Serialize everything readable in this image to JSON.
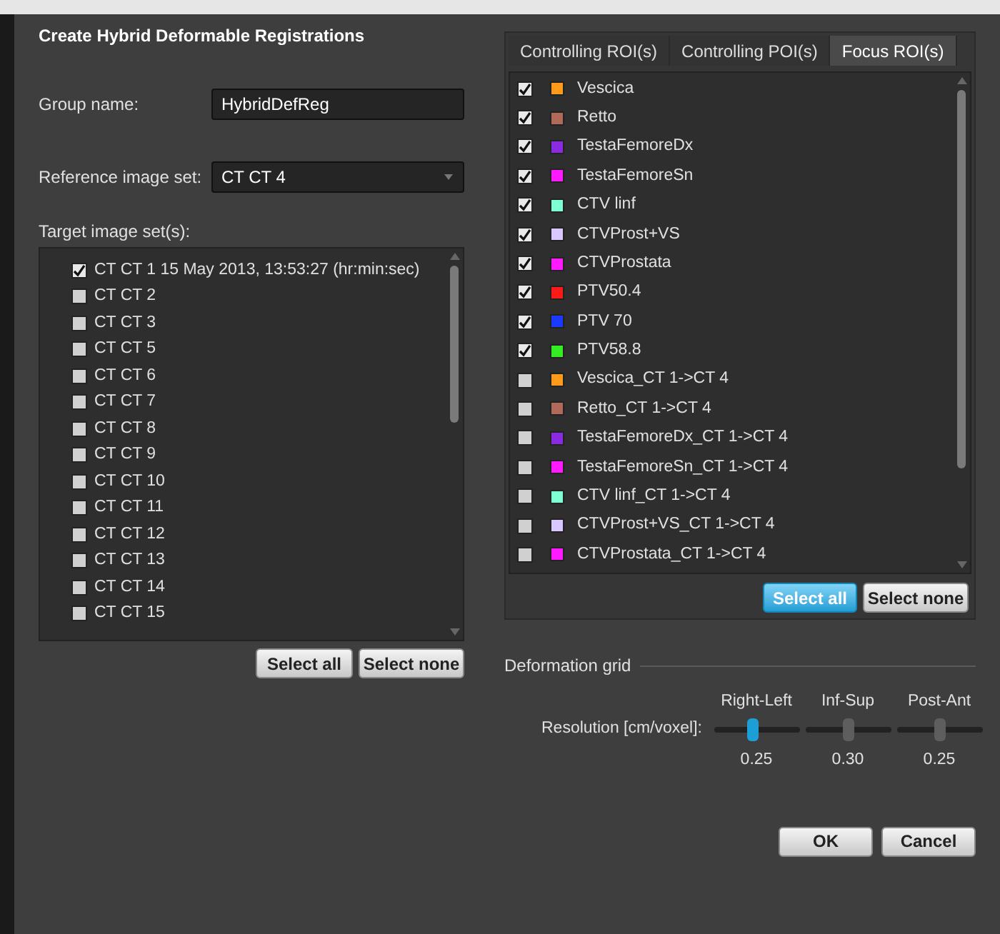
{
  "dialog": {
    "title": "Create Hybrid Deformable Registrations"
  },
  "group_name": {
    "label": "Group name:",
    "value": "HybridDefReg"
  },
  "reference_image_set": {
    "label": "Reference image set:",
    "value": "CT CT 4"
  },
  "target_image_sets": {
    "label": "Target image set(s):",
    "items": [
      {
        "label": "CT CT 1 15 May 2013, 13:53:27 (hr:min:sec)",
        "checked": true
      },
      {
        "label": "CT CT 2",
        "checked": false
      },
      {
        "label": "CT CT 3",
        "checked": false
      },
      {
        "label": "CT CT 5",
        "checked": false
      },
      {
        "label": "CT CT 6",
        "checked": false
      },
      {
        "label": "CT CT 7",
        "checked": false
      },
      {
        "label": "CT CT 8",
        "checked": false
      },
      {
        "label": "CT CT 9",
        "checked": false
      },
      {
        "label": "CT CT 10",
        "checked": false
      },
      {
        "label": "CT CT 11",
        "checked": false
      },
      {
        "label": "CT CT 12",
        "checked": false
      },
      {
        "label": "CT CT 13",
        "checked": false
      },
      {
        "label": "CT CT 14",
        "checked": false
      },
      {
        "label": "CT CT 15",
        "checked": false
      }
    ],
    "buttons": [
      {
        "label": "Select all",
        "highlighted": false
      },
      {
        "label": "Select none",
        "highlighted": false
      }
    ]
  },
  "tabs": [
    {
      "label": "Controlling ROI(s)",
      "selected": false
    },
    {
      "label": "Controlling POI(s)",
      "selected": false
    },
    {
      "label": "Focus ROI(s)",
      "selected": true
    }
  ],
  "rois": {
    "items": [
      {
        "label": "Vescica",
        "checked": true,
        "color": "#ff9a1a"
      },
      {
        "label": "Retto",
        "checked": true,
        "color": "#b06a5a"
      },
      {
        "label": "TestaFemoreDx",
        "checked": true,
        "color": "#8a2be2"
      },
      {
        "label": "TestaFemoreSn",
        "checked": true,
        "color": "#ff1aff"
      },
      {
        "label": "CTV linf",
        "checked": true,
        "color": "#7fffd4"
      },
      {
        "label": "CTVProst+VS",
        "checked": true,
        "color": "#d8c8ff"
      },
      {
        "label": "CTVProstata",
        "checked": true,
        "color": "#ff1aff"
      },
      {
        "label": "PTV50.4",
        "checked": true,
        "color": "#ff1a1a"
      },
      {
        "label": "PTV 70",
        "checked": true,
        "color": "#1a3aff"
      },
      {
        "label": "PTV58.8",
        "checked": true,
        "color": "#33ee22"
      },
      {
        "label": "Vescica_CT 1->CT 4",
        "checked": false,
        "color": "#ff9a1a"
      },
      {
        "label": "Retto_CT 1->CT 4",
        "checked": false,
        "color": "#b06a5a"
      },
      {
        "label": "TestaFemoreDx_CT 1->CT 4",
        "checked": false,
        "color": "#8a2be2"
      },
      {
        "label": "TestaFemoreSn_CT 1->CT 4",
        "checked": false,
        "color": "#ff1aff"
      },
      {
        "label": "CTV linf_CT 1->CT 4",
        "checked": false,
        "color": "#7fffd4"
      },
      {
        "label": "CTVProst+VS_CT 1->CT 4",
        "checked": false,
        "color": "#d8c8ff"
      },
      {
        "label": "CTVProstata_CT 1->CT 4",
        "checked": false,
        "color": "#ff1aff"
      }
    ],
    "buttons": [
      {
        "label": "Select all",
        "highlighted": true
      },
      {
        "label": "Select none",
        "highlighted": false
      }
    ]
  },
  "deformation_grid": {
    "title": "Deformation grid",
    "resolution_label": "Resolution [cm/voxel]:",
    "sliders": [
      {
        "name": "Right-Left",
        "level": 0.45,
        "reading": "0.25",
        "focused": true
      },
      {
        "name": "Inf-Sup",
        "level": 0.5,
        "reading": "0.30",
        "focused": false
      },
      {
        "name": "Post-Ant",
        "level": 0.5,
        "reading": "0.25",
        "focused": false
      }
    ]
  },
  "buttons": [
    {
      "label": "OK"
    },
    {
      "label": "Cancel"
    }
  ]
}
